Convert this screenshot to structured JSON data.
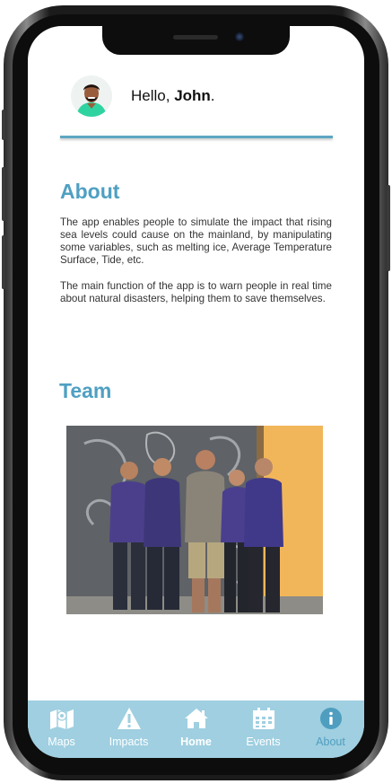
{
  "header": {
    "greeting_prefix": "Hello, ",
    "user_name": "John",
    "greeting_suffix": "."
  },
  "about": {
    "title": "About",
    "paragraph1": "The app enables people to simulate the impact that rising sea levels could cause on the mainland, by manipulating some variables, such as melting ice, Average Temperature Surface, Tide, etc.",
    "paragraph2": "The main function of the app is to warn people in real time about natural disasters, helping them to save themselves."
  },
  "team": {
    "title": "Team",
    "members_count": 5
  },
  "tabbar": {
    "tabs": [
      {
        "label": "Maps",
        "icon": "map-icon"
      },
      {
        "label": "Impacts",
        "icon": "warning-icon"
      },
      {
        "label": "Home",
        "icon": "home-icon"
      },
      {
        "label": "Events",
        "icon": "calendar-icon"
      },
      {
        "label": "About",
        "icon": "info-icon"
      }
    ],
    "selected": "About"
  },
  "colors": {
    "accent": "#4fa0c2",
    "tabbar_bg": "#9fcfe0",
    "divider": "#5ea6c3"
  }
}
